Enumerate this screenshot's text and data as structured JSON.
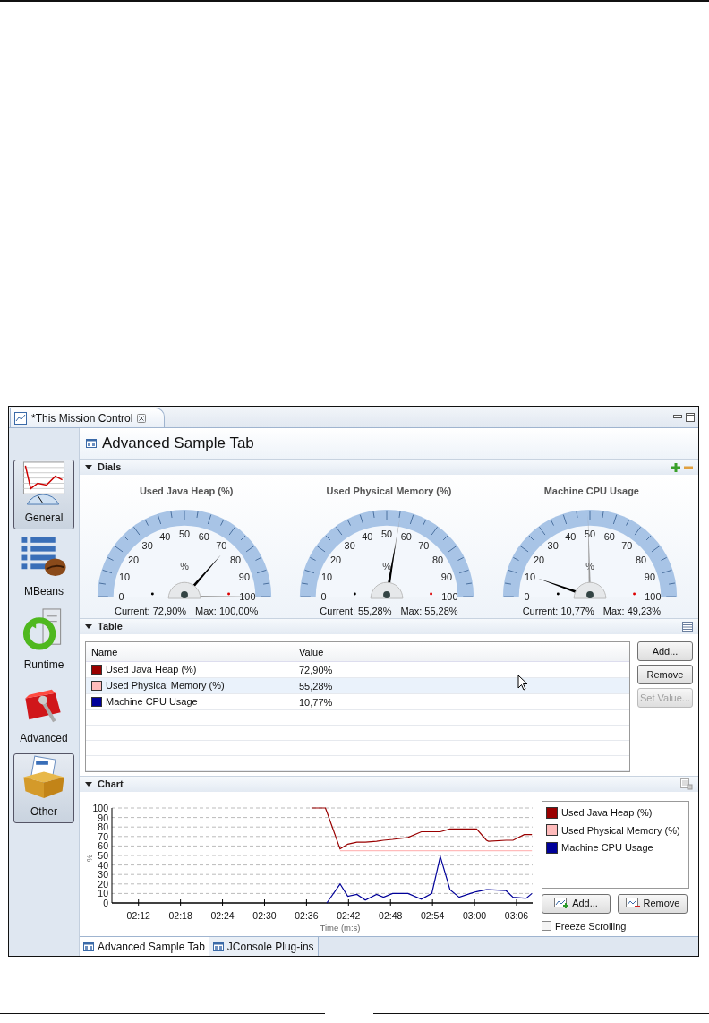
{
  "editor_tab": {
    "title": "*This Mission Control"
  },
  "sidebar": {
    "items": [
      {
        "label": "General",
        "kind": "general",
        "selected": true
      },
      {
        "label": "MBeans",
        "kind": "mbeans",
        "selected": false
      },
      {
        "label": "Runtime",
        "kind": "runtime",
        "selected": false
      },
      {
        "label": "Advanced",
        "kind": "advanced",
        "selected": false
      },
      {
        "label": "Other",
        "kind": "other",
        "selected": true
      }
    ]
  },
  "page_title": "Advanced Sample Tab",
  "dials_section": {
    "title": "Dials",
    "dials": [
      {
        "title": "Used Java Heap (%)",
        "ticks": [
          "0",
          "10",
          "20",
          "30",
          "40",
          "50",
          "60",
          "70",
          "80",
          "90",
          "100"
        ],
        "unit": "%",
        "current": "Current: 72,90%",
        "max": "Max: 100,00%"
      },
      {
        "title": "Used Physical Memory (%)",
        "ticks": [
          "0",
          "10",
          "20",
          "30",
          "40",
          "50",
          "60",
          "70",
          "80",
          "90",
          "100"
        ],
        "unit": "%",
        "current": "Current: 55,28%",
        "max": "Max: 55,28%"
      },
      {
        "title": "Machine CPU Usage",
        "ticks": [
          "0",
          "10",
          "20",
          "30",
          "40",
          "50",
          "60",
          "70",
          "80",
          "90",
          "100"
        ],
        "unit": "%",
        "current": "Current: 10,77%",
        "max": "Max: 49,23%"
      }
    ]
  },
  "table_section": {
    "title": "Table",
    "columns": [
      "Name",
      "Value"
    ],
    "rows": [
      {
        "name": "Used Java Heap (%)",
        "value": "72,90%",
        "color": "#990000",
        "selected": false
      },
      {
        "name": "Used Physical Memory (%)",
        "value": "55,28%",
        "color": "#ffbbbb",
        "selected": true
      },
      {
        "name": "Machine CPU Usage",
        "value": "10,77%",
        "color": "#000099",
        "selected": false
      }
    ],
    "buttons": [
      {
        "label": "Add...",
        "disabled": false
      },
      {
        "label": "Remove",
        "disabled": false
      },
      {
        "label": "Set Value...",
        "disabled": true
      }
    ]
  },
  "chart_section": {
    "title": "Chart",
    "chart_data": {
      "type": "line",
      "grid": true,
      "xlabel": "Time (m:s)",
      "ylabel": "%",
      "xlim": [
        128.2,
        188.3
      ],
      "ylim": [
        0,
        100
      ],
      "xticks": [
        {
          "value": 132,
          "label": "02:12"
        },
        {
          "value": 138,
          "label": "02:18"
        },
        {
          "value": 144,
          "label": "02:24"
        },
        {
          "value": 150,
          "label": "02:30"
        },
        {
          "value": 156,
          "label": "02:36"
        },
        {
          "value": 162,
          "label": "02:42"
        },
        {
          "value": 168,
          "label": "02:48"
        },
        {
          "value": 174,
          "label": "02:54"
        },
        {
          "value": 180,
          "label": "03:00"
        },
        {
          "value": 186,
          "label": "03:06"
        }
      ],
      "yticks": [
        0,
        10,
        20,
        30,
        40,
        50,
        60,
        70,
        80,
        90,
        100
      ],
      "x": [
        156.7,
        158.7,
        158.9,
        160.8,
        161.9,
        163.2,
        164.4,
        166,
        167,
        168.3,
        170.5,
        172.4,
        173.9,
        175.1,
        176.5,
        177.8,
        179.4,
        180.3,
        181.7,
        182,
        184.5,
        185.5,
        187.1,
        187.4,
        188.2
      ],
      "series": [
        {
          "name": "Used Java Heap (%)",
          "color": "#990000",
          "values": [
            100,
            100,
            96,
            57,
            62,
            64,
            64,
            65,
            66,
            67,
            69,
            75,
            75,
            75,
            78,
            78,
            78,
            78,
            66,
            65,
            66,
            66,
            72,
            72,
            72
          ]
        },
        {
          "name": "Used Physical Memory (%)",
          "color": "#ffbbbb",
          "values": [
            null,
            null,
            null,
            55,
            55,
            55,
            55,
            55,
            55,
            55,
            55,
            55,
            55,
            55,
            55,
            55,
            55,
            55,
            55,
            55,
            55,
            55,
            55,
            55,
            55
          ]
        },
        {
          "name": "Machine CPU Usage",
          "color": "#000099",
          "values": [
            null,
            null,
            0,
            20,
            7,
            9,
            3,
            9,
            6,
            10,
            10,
            4,
            10,
            49,
            14,
            6,
            10,
            12,
            14,
            14,
            13,
            6,
            5,
            5,
            10
          ]
        }
      ]
    },
    "buttons": [
      {
        "label": "Add...",
        "kind": "add"
      },
      {
        "label": "Remove",
        "kind": "remove"
      }
    ],
    "freeze_scrolling": {
      "label": "Freeze Scrolling",
      "checked": false
    }
  },
  "bottom_tabs": [
    {
      "label": "Advanced Sample Tab",
      "selected": true
    },
    {
      "label": "JConsole Plug-ins",
      "selected": false
    }
  ]
}
